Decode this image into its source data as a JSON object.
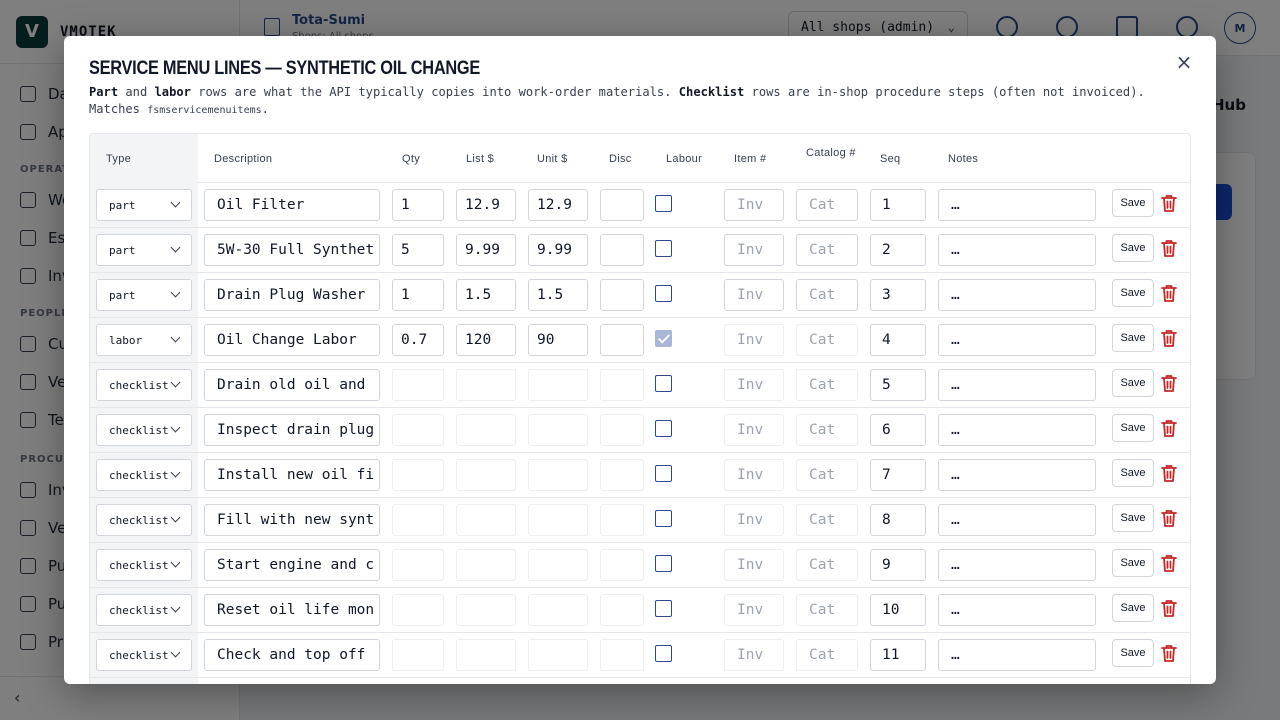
{
  "app": {
    "brand": "VMOTEK",
    "brand_logo": "V",
    "org_title": "Tota-Sumi",
    "org_sub": "Shops: All shops",
    "shop_select": "All shops (admin)",
    "avatar": "M",
    "hub_label": "Hub",
    "nav_sections": [
      "OPERATI",
      "PEOPLE",
      "PROCURE"
    ],
    "nav_items": [
      "Da",
      "Ap",
      "Wo",
      "Es",
      "Inv",
      "Cu",
      "Ve",
      "Te",
      "Inv",
      "Ve",
      "Pu",
      "Pu",
      "Pr"
    ]
  },
  "modal": {
    "title": "SERVICE MENU LINES — SYNTHETIC OIL CHANGE",
    "desc": {
      "part": "Part",
      "and": " and ",
      "labor": "labor",
      "mid": " rows are what the API typically copies into work-order materials. ",
      "checklist": "Checklist",
      "tail": " rows are in-shop procedure steps (often not invoiced). Matches ",
      "table_name": "fsmservicemenuitems",
      "end": "."
    },
    "columns": {
      "type": "Type",
      "description": "Description",
      "qty": "Qty",
      "list": "List $",
      "unit": "Unit $",
      "disc": "Disc",
      "labour": "Labour",
      "item": "Item #",
      "catalog": "Catalog #",
      "seq": "Seq",
      "notes": "Notes"
    },
    "placeholders": {
      "item": "Inv",
      "catalog": "Cat",
      "notes": "…"
    },
    "save_label": "Save",
    "close_icon": "×",
    "rows": [
      {
        "type": "part",
        "desc": "Oil Filter",
        "qty": "1",
        "list": "12.9",
        "unit": "12.9",
        "disc": "",
        "labour": false,
        "seq": "1"
      },
      {
        "type": "part",
        "desc": "5W-30 Full Synthet",
        "qty": "5",
        "list": "9.99",
        "unit": "9.99",
        "disc": "",
        "labour": false,
        "seq": "2"
      },
      {
        "type": "part",
        "desc": "Drain Plug Washer",
        "qty": "1",
        "list": "1.5",
        "unit": "1.5",
        "disc": "",
        "labour": false,
        "seq": "3"
      },
      {
        "type": "labor",
        "desc": "Oil Change Labor",
        "qty": "0.7",
        "list": "120",
        "unit": "90",
        "disc": "",
        "labour": true,
        "seq": "4"
      },
      {
        "type": "checklist",
        "desc": "Drain old oil and",
        "qty": "",
        "list": "",
        "unit": "",
        "disc": "",
        "labour": false,
        "seq": "5"
      },
      {
        "type": "checklist",
        "desc": "Inspect drain plug",
        "qty": "",
        "list": "",
        "unit": "",
        "disc": "",
        "labour": false,
        "seq": "6"
      },
      {
        "type": "checklist",
        "desc": "Install new oil fi",
        "qty": "",
        "list": "",
        "unit": "",
        "disc": "",
        "labour": false,
        "seq": "7"
      },
      {
        "type": "checklist",
        "desc": "Fill with new synt",
        "qty": "",
        "list": "",
        "unit": "",
        "disc": "",
        "labour": false,
        "seq": "8"
      },
      {
        "type": "checklist",
        "desc": "Start engine and c",
        "qty": "",
        "list": "",
        "unit": "",
        "disc": "",
        "labour": false,
        "seq": "9"
      },
      {
        "type": "checklist",
        "desc": "Reset oil life mon",
        "qty": "",
        "list": "",
        "unit": "",
        "disc": "",
        "labour": false,
        "seq": "10"
      },
      {
        "type": "checklist",
        "desc": "Check and top off",
        "qty": "",
        "list": "",
        "unit": "",
        "disc": "",
        "labour": false,
        "seq": "11"
      }
    ]
  },
  "colors": {
    "accent": "#2d4a8a",
    "danger": "#c62828",
    "checked": "#a9b6d9"
  }
}
